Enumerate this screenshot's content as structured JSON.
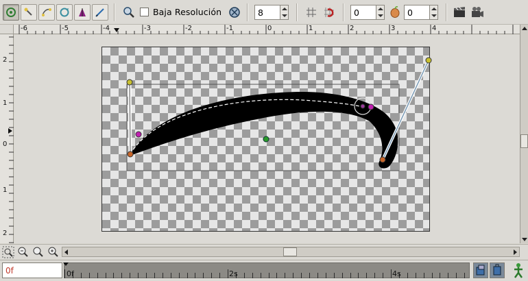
{
  "toolbar": {
    "tools": [
      "transform-tool",
      "smooth-move-tool",
      "scale-tool",
      "rotate-tool",
      "mirror-tool",
      "draw-tool"
    ],
    "low_res_label": "Baja Resolución",
    "low_res_checked": false,
    "spin_value": "8",
    "onion_past": "0",
    "onion_future": "0"
  },
  "rulers": {
    "h_labels": [
      "-6",
      "-5",
      "-4",
      "-3",
      "-2",
      "-1",
      "0",
      "1",
      "2",
      "3",
      "4"
    ],
    "v_labels": [
      "2",
      "1",
      "0",
      "1",
      "2"
    ]
  },
  "timebar": {
    "current_time": "0f",
    "labels": [
      "0f",
      "2s",
      "4s"
    ]
  }
}
